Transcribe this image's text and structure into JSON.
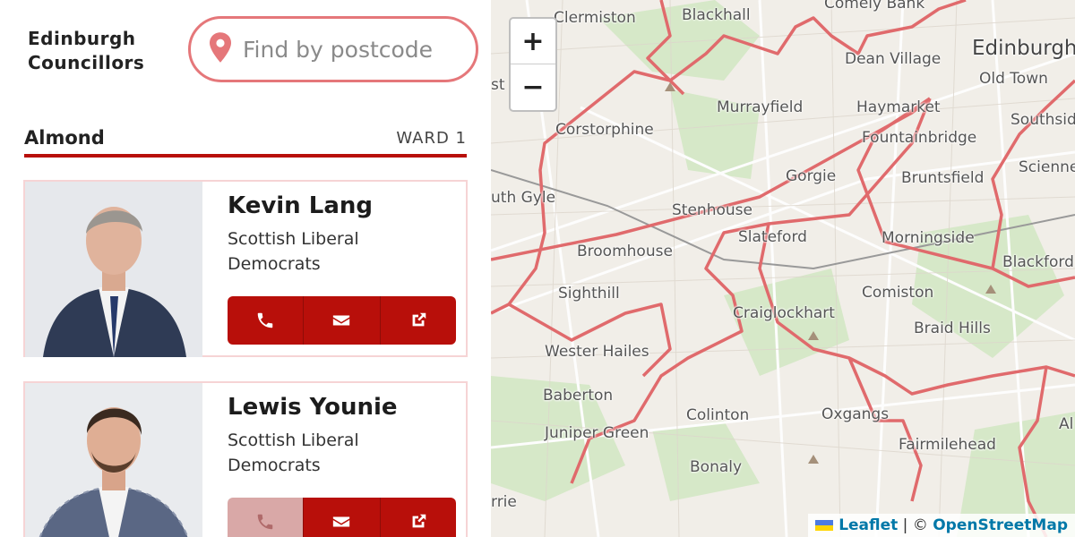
{
  "brand": {
    "line1": "Edinburgh",
    "line2": "Councillors"
  },
  "search": {
    "placeholder": "Find by postcode",
    "value": ""
  },
  "ward": {
    "name": "Almond",
    "number_label": "WARD 1"
  },
  "councillors": [
    {
      "name": "Kevin Lang",
      "party": "Scottish Liberal Democrats",
      "phone_enabled": true
    },
    {
      "name": "Lewis Younie",
      "party": "Scottish Liberal Democrats",
      "phone_enabled": false
    }
  ],
  "actions": {
    "phone_icon": "phone-icon",
    "email_icon": "envelope-icon",
    "link_icon": "external-link-icon"
  },
  "map": {
    "zoom_in": "+",
    "zoom_out": "−",
    "places": {
      "clermiston": "Clermiston",
      "blackhall": "Blackhall",
      "comely_bank": "Comely Bank",
      "dean_village": "Dean Village",
      "edinburgh": "Edinburgh",
      "old_town": "Old Town",
      "murrayfield": "Murrayfield",
      "haymarket": "Haymarket",
      "southside": "Southsid",
      "corstorphine": "Corstorphine",
      "fountainbridge": "Fountainbridge",
      "sciennes": "Sciennes",
      "gorgie": "Gorgie",
      "bruntsfield": "Bruntsfield",
      "south_gyle": "uth Gyle",
      "stenhouse": "Stenhouse",
      "slateford": "Slateford",
      "morningside": "Morningside",
      "broomhouse": "Broomhouse",
      "blackford": "Blackford",
      "sighthill": "Sighthill",
      "comiston": "Comiston",
      "craiglockhart": "Craiglockhart",
      "braid_hills": "Braid Hills",
      "wester_hailes": "Wester Hailes",
      "baberton": "Baberton",
      "colinton": "Colinton",
      "oxgangs": "Oxgangs",
      "juniper_green": "Juniper Green",
      "fairmilehead": "Fairmilehead",
      "bonaly": "Bonaly",
      "ratho_station": "st",
      "currie": "rrie",
      "alnwickhill": "Al"
    },
    "attribution": {
      "leaflet": "Leaflet",
      "separator": " | © ",
      "osm": "OpenStreetMap"
    },
    "colors": {
      "boundary": "#e06a6c",
      "accent": "#b80f0a"
    }
  }
}
